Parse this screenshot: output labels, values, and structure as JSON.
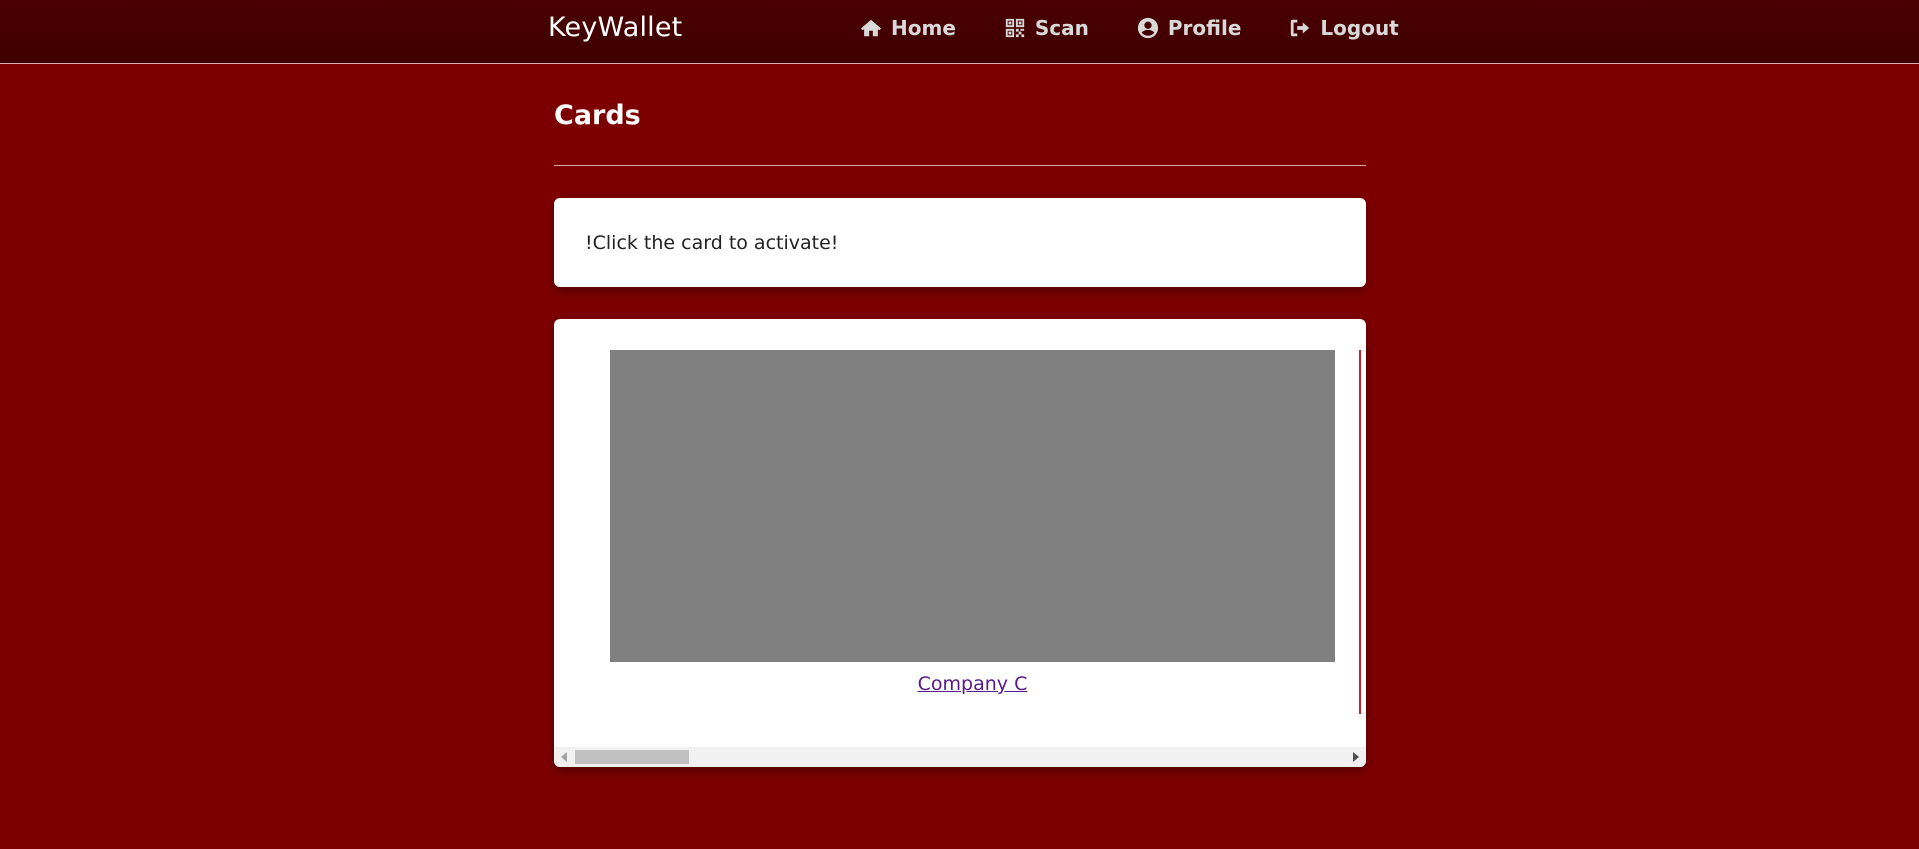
{
  "navbar": {
    "brand": "KeyWallet",
    "links": [
      {
        "label": "Home",
        "icon": "home-icon"
      },
      {
        "label": "Scan",
        "icon": "qrcode-icon"
      },
      {
        "label": "Profile",
        "icon": "user-circle-icon"
      },
      {
        "label": "Logout",
        "icon": "sign-out-icon"
      }
    ]
  },
  "page": {
    "title": "Cards",
    "notice": "!Click the card to activate!"
  },
  "cards": [
    {
      "name": "Company C",
      "image_color": "#808080"
    }
  ],
  "colors": {
    "background": "#7d0000",
    "navbar": "#450000",
    "link_visited": "#551a8b"
  }
}
